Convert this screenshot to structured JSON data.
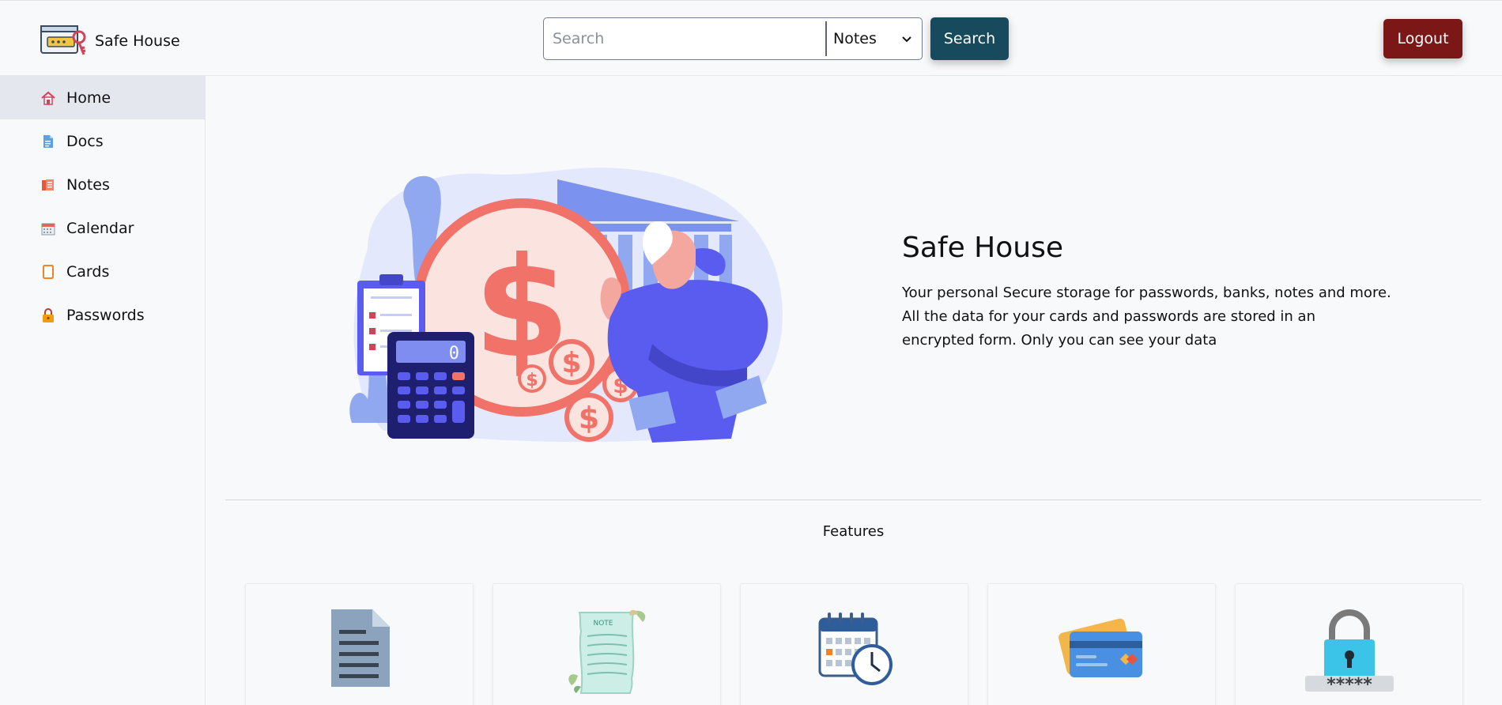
{
  "app": {
    "brand_name": "Safe House"
  },
  "header": {
    "search_placeholder": "Search",
    "search_value": "",
    "category_selected": "Notes",
    "search_button": "Search",
    "logout_button": "Logout"
  },
  "sidebar": {
    "items": [
      {
        "label": "Home",
        "icon": "home-icon",
        "active": true
      },
      {
        "label": "Docs",
        "icon": "docs-icon"
      },
      {
        "label": "Notes",
        "icon": "notes-icon"
      },
      {
        "label": "Calendar",
        "icon": "calendar-icon"
      },
      {
        "label": "Cards",
        "icon": "cards-icon"
      },
      {
        "label": "Passwords",
        "icon": "lock-icon"
      }
    ]
  },
  "hero": {
    "title": "Safe House",
    "description": "Your personal Secure storage for passwords, banks, notes and more. All the data for your cards and passwords are stored in an encrypted form. Only you can see your data",
    "calculator_display": "0"
  },
  "features": {
    "title": "Features",
    "cards": [
      {
        "icon": "document-icon"
      },
      {
        "icon": "note-icon",
        "label": "NOTE"
      },
      {
        "icon": "calendar-clock-icon"
      },
      {
        "icon": "credit-card-icon"
      },
      {
        "icon": "password-lock-icon",
        "mask": "*****"
      }
    ]
  },
  "colors": {
    "search_button": "#174a5c",
    "logout_button": "#7b1717",
    "sidebar_active": "#e4e8ee",
    "illustration_red": "#f07268",
    "illustration_blue": "#5a5cf0"
  }
}
